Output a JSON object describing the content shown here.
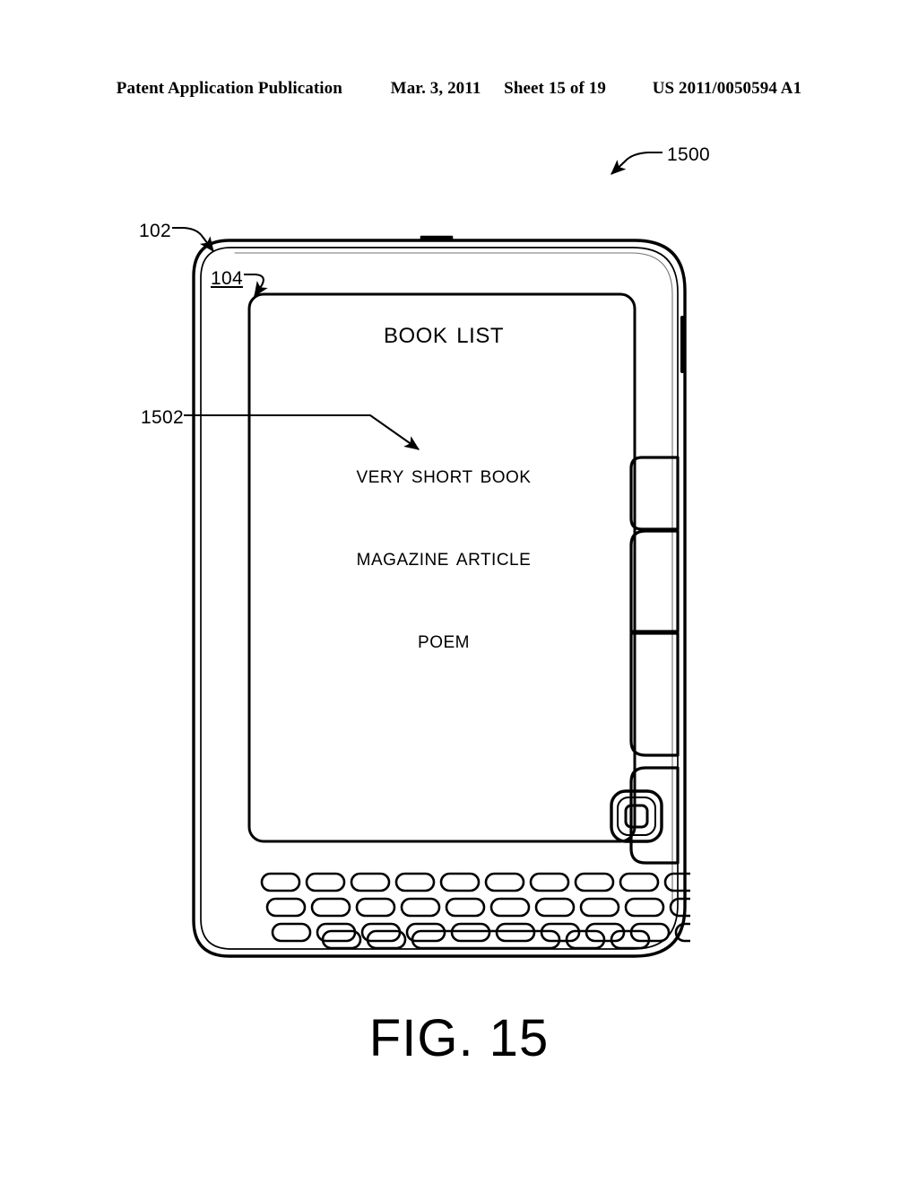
{
  "header": {
    "publication": "Patent Application Publication",
    "date": "Mar. 3, 2011",
    "sheet": "Sheet 15 of 19",
    "patent_number": "US 2011/0050594 A1"
  },
  "figure": {
    "caption": "FIG. 15",
    "figure_ref": "1500"
  },
  "reference_numerals": {
    "device_body": "102",
    "display_screen": "104",
    "list_item_callout": "1502",
    "figure": "1500"
  },
  "device": {
    "screen": {
      "title": "Book List",
      "items": [
        {
          "label": "Very Short Book"
        },
        {
          "label": "Magazine Article"
        },
        {
          "label": "Poem"
        }
      ]
    },
    "controls": {
      "top_right_button": "menu-button",
      "page_back_button": "page-back-button",
      "page_forward_button": "page-forward-button",
      "five_way_controller": "five-way-controller",
      "keyboard_rows": [
        10,
        10,
        10
      ],
      "keyboard_bottom_row": {
        "left_keys": 2,
        "space_bar": 1,
        "right_keys": 2
      }
    }
  },
  "colors": {
    "ink": "#000000",
    "paper": "#ffffff",
    "key_shadow": "#8a8a8a"
  }
}
